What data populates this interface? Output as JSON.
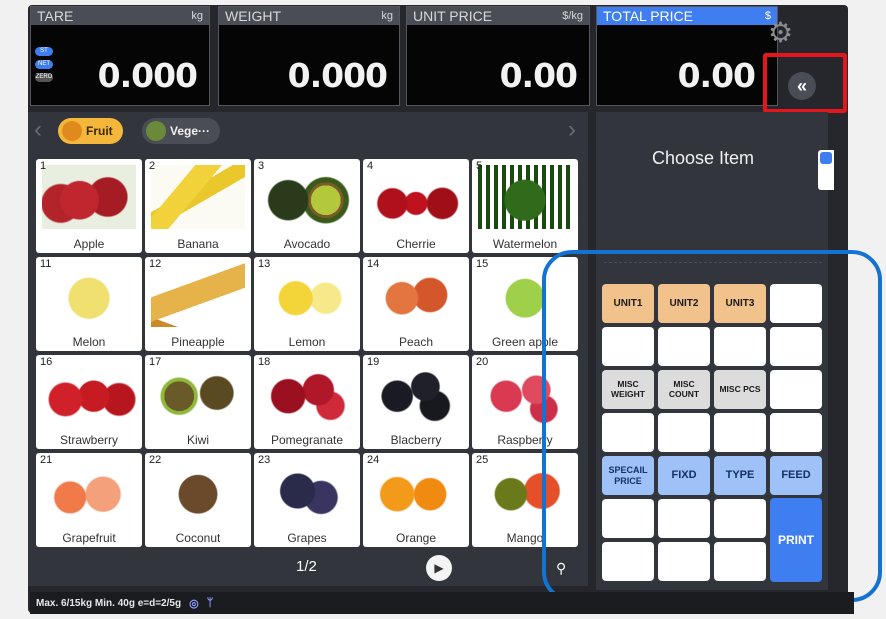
{
  "displays": {
    "tare": {
      "label": "TARE",
      "unit": "kg",
      "value": "0.000"
    },
    "weight": {
      "label": "WEIGHT",
      "unit": "kg",
      "value": "0.000"
    },
    "unit_price": {
      "label": "UNIT PRICE",
      "unit": "$/kg",
      "value": "0.00"
    },
    "total_price": {
      "label": "TOTAL PRICE",
      "unit": "$",
      "value": "0.00"
    }
  },
  "indicators": [
    "ST",
    "NET",
    "ZERO"
  ],
  "categories": [
    {
      "label": "Fruit",
      "color": "#f5b73b"
    },
    {
      "label": "Vege···",
      "color": "#4a4d55"
    }
  ],
  "products": [
    {
      "num": "1",
      "name": "Apple"
    },
    {
      "num": "2",
      "name": "Banana"
    },
    {
      "num": "3",
      "name": "Avocado"
    },
    {
      "num": "4",
      "name": "Cherrie"
    },
    {
      "num": "5",
      "name": "Watermelon"
    },
    {
      "num": "11",
      "name": "Melon"
    },
    {
      "num": "12",
      "name": "Pineapple"
    },
    {
      "num": "13",
      "name": "Lemon"
    },
    {
      "num": "14",
      "name": "Peach"
    },
    {
      "num": "15",
      "name": "Green apple"
    },
    {
      "num": "16",
      "name": "Strawberry"
    },
    {
      "num": "17",
      "name": "Kiwi"
    },
    {
      "num": "18",
      "name": "Pomegranate"
    },
    {
      "num": "19",
      "name": "Blacberry"
    },
    {
      "num": "20",
      "name": "Raspberry"
    },
    {
      "num": "21",
      "name": "Grapefruit"
    },
    {
      "num": "22",
      "name": "Coconut"
    },
    {
      "num": "23",
      "name": "Grapes"
    },
    {
      "num": "24",
      "name": "Orange"
    },
    {
      "num": "25",
      "name": "Mango"
    }
  ],
  "pager": "1/2",
  "right_panel": {
    "choose_item": "Choose Item"
  },
  "keys": {
    "unit1": "UNIT1",
    "unit2": "UNIT2",
    "unit3": "UNIT3",
    "misc_weight": "MISC WEIGHT",
    "misc_count": "MISC COUNT",
    "misc_pcs": "MISC PCS",
    "special_price": "SPECAIL PRICE",
    "fixd": "FIXD",
    "type": "TYPE",
    "feed": "FEED",
    "print": "PRINT"
  },
  "status_bar": {
    "text": "Max. 6/15kg  Min. 40g  e=d=2/5g"
  },
  "colors": {
    "accent": "#3f7ef0",
    "highlight_red": "#e6151b",
    "highlight_blue": "#1273d2",
    "unit_key": "#f2c28d"
  }
}
